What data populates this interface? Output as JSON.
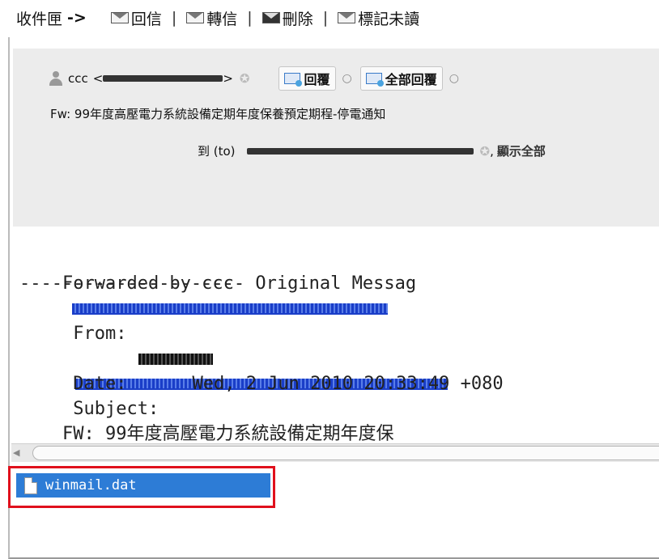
{
  "toolbar": {
    "inbox_label": "收件匣",
    "arrow": "->",
    "reply_label": "回信",
    "forward_label": "轉信",
    "delete_label": "刪除",
    "mark_unread_label": "標記未讀",
    "separator": "|"
  },
  "header": {
    "sender_name": "ccc",
    "reply_button": "回覆",
    "reply_all_button": "全部回覆",
    "subject": "Fw: 99年度高壓電力系統設備定期年度保養預定期程-停電通知",
    "to_label": "到 (to)",
    "show_all": "顯示全部"
  },
  "body": {
    "forwarded_by": "Forwarded by ccc",
    "original_message": "--------------------- Original Messag",
    "from_label": " From:",
    "date_label": " Date:",
    "date_value": "Wed, 2 Jun 2010 20:33:49 +080",
    "subject_label": " Subject:",
    "subject_value": "FW: 99年度高壓電力系統設備定期年度保",
    "trailing": "----"
  },
  "attachments": [
    {
      "filename": "winmail.dat"
    }
  ],
  "colors": {
    "selection": "#2d7cd6",
    "highlight_box": "#e0101c",
    "link": "#1a3ec8",
    "header_bg": "#ececec"
  }
}
